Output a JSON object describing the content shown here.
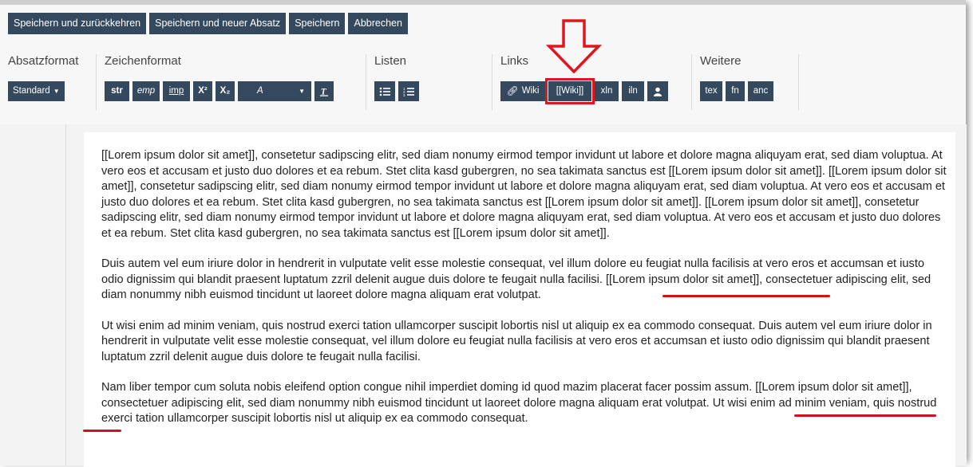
{
  "top_buttons": [
    "Speichern und zurückkehren",
    "Speichern und neuer Absatz",
    "Speichern",
    "Abbrechen"
  ],
  "groups": {
    "absatzformat": {
      "title": "Absatzformat",
      "dropdown": "Standard"
    },
    "zeichenformat": {
      "title": "Zeichenformat",
      "buttons": [
        "str",
        "emp",
        "imp",
        "X²",
        "X₂",
        "A"
      ]
    },
    "listen": {
      "title": "Listen"
    },
    "links": {
      "title": "Links",
      "buttons": [
        "Wiki",
        "[[Wiki]]",
        "xln",
        "iln"
      ]
    },
    "weitere": {
      "title": "Weitere",
      "buttons": [
        "tex",
        "fn",
        "anc"
      ]
    }
  },
  "content": {
    "p1": "[[Lorem ipsum dolor sit amet]], consetetur sadipscing elitr, sed diam nonumy eirmod tempor invidunt ut labore et dolore magna aliquyam erat, sed diam voluptua. At vero eos et accusam et justo duo dolores et ea rebum. Stet clita kasd gubergren, no sea takimata sanctus est [[Lorem ipsum dolor sit amet]]. [[Lorem ipsum dolor sit amet]], consetetur sadipscing elitr, sed diam nonumy eirmod tempor invidunt ut labore et dolore magna aliquyam erat, sed diam voluptua. At vero eos et accusam et justo duo dolores et ea rebum. Stet clita kasd gubergren, no sea takimata sanctus est [[Lorem ipsum dolor sit amet]]. [[Lorem ipsum dolor sit amet]], consetetur sadipscing elitr, sed diam nonumy eirmod tempor invidunt ut labore et dolore magna aliquyam erat, sed diam voluptua. At vero eos et accusam et justo duo dolores et ea rebum. Stet clita kasd gubergren, no sea takimata sanctus est [[Lorem ipsum dolor sit amet]].",
    "p2": "Duis autem vel eum iriure dolor in hendrerit in vulputate velit esse molestie consequat, vel illum dolore eu feugiat nulla facilisis at vero eros et accumsan et iusto odio dignissim qui blandit praesent luptatum zzril delenit augue duis dolore te feugait nulla facilisi. [[Lorem ipsum dolor sit amet]], consectetuer adipiscing elit, sed diam nonummy nibh euismod tincidunt ut laoreet dolore magna aliquam erat volutpat.",
    "p3": "Ut wisi enim ad minim veniam, quis nostrud exerci tation ullamcorper suscipit lobortis nisl ut aliquip ex ea commodo consequat. Duis autem vel eum iriure dolor in hendrerit in vulputate velit esse molestie consequat, vel illum dolore eu feugiat nulla facilisis at vero eros et accumsan et iusto odio dignissim qui blandit praesent luptatum zzril delenit augue duis dolore te feugait nulla facilisi.",
    "p4": "Nam liber tempor cum soluta nobis eleifend option congue nihil imperdiet doming id quod mazim placerat facer possim assum. [[Lorem ipsum dolor sit amet]], consectetuer adipiscing elit, sed diam nonummy nibh euismod tincidunt ut laoreet dolore magna aliquam erat volutpat. Ut wisi enim ad minim veniam, quis nostrud exerci tation ullamcorper suscipit lobortis nisl ut aliquip ex ea commodo consequat."
  },
  "colors": {
    "button": "#34495e",
    "annotation_red": "#e0151d"
  }
}
